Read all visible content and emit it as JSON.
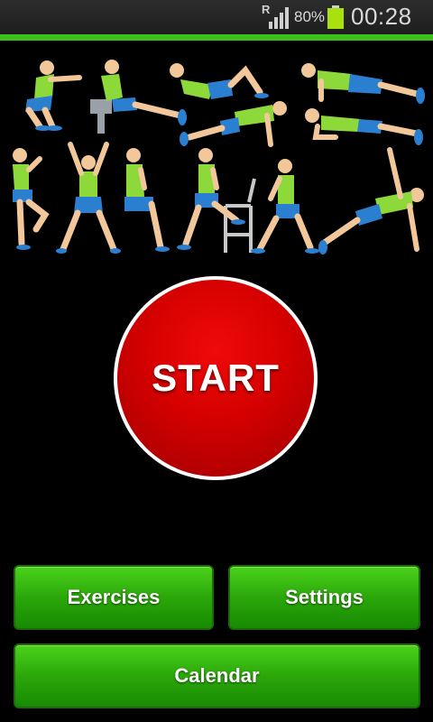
{
  "status_bar": {
    "roaming_indicator": "R",
    "battery_percent": "80%",
    "time": "00:28",
    "signal_icon": "signal-bars-icon",
    "battery_icon": "battery-icon",
    "accent_color": "#3fbf1d"
  },
  "illustration": {
    "icon": "exercise-figures-illustration",
    "shirt_color": "#8ed93a",
    "shorts_color": "#2a7fd0"
  },
  "start_button": {
    "label": "START",
    "color": "#d40000"
  },
  "buttons": {
    "exercises": "Exercises",
    "settings": "Settings",
    "calendar": "Calendar",
    "color": "#2ca80a"
  }
}
